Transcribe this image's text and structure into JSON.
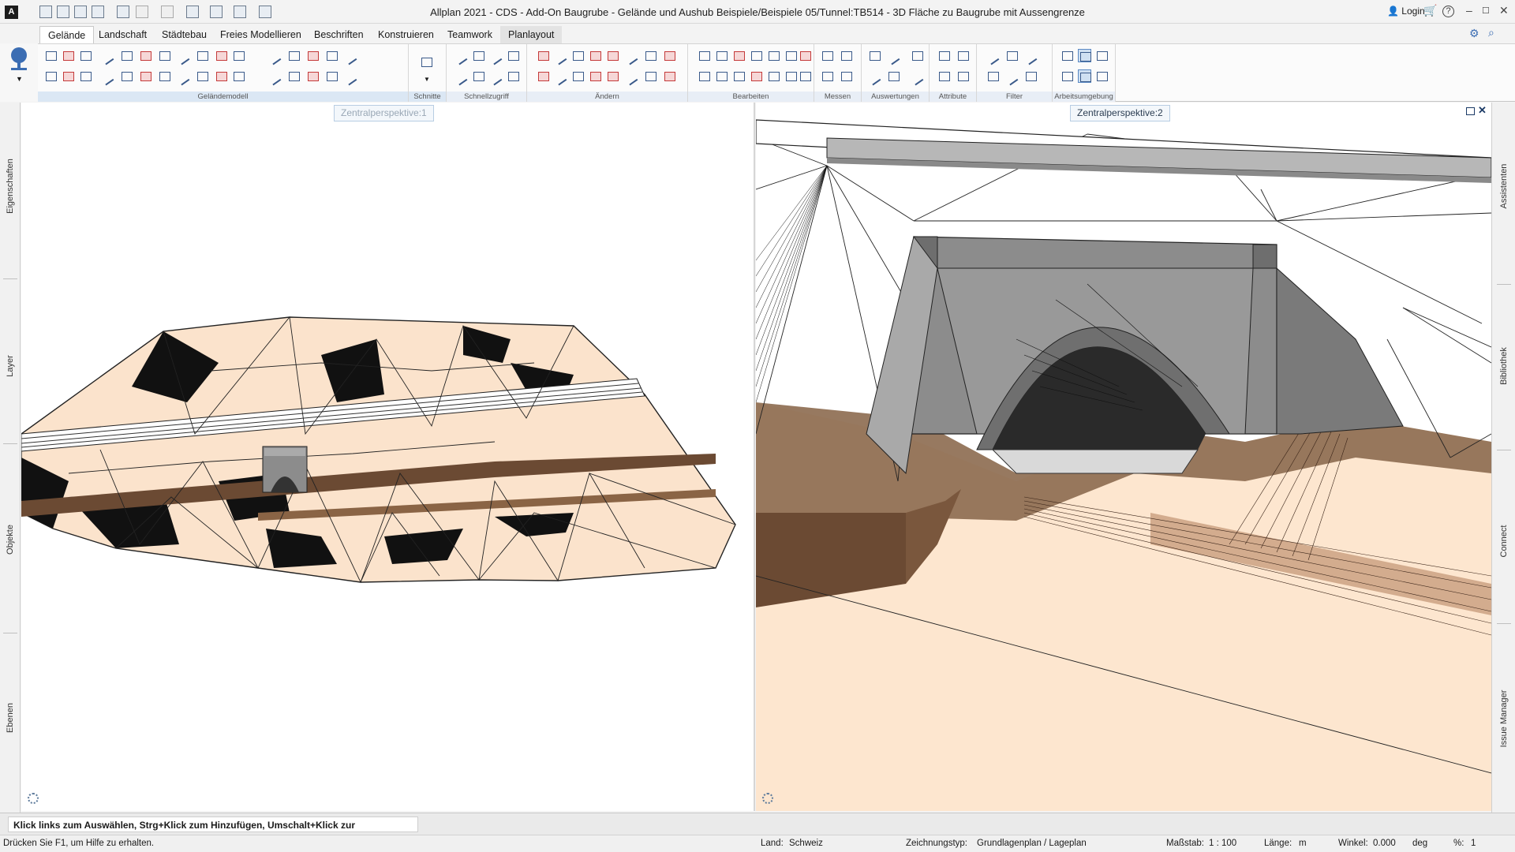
{
  "app": {
    "title": "Allplan 2021 - CDS - Add-On Baugrube - Gelände und Aushub Beispiele/Beispiele 05/Tunnel:TB514 - 3D Fläche zu Baugrube mit Aussengrenze",
    "logo_letter": "A",
    "login_label": "Login",
    "help_glyph": "?",
    "window_controls": [
      "–",
      "☐",
      "✕"
    ]
  },
  "tabs": [
    {
      "label": "Gelände",
      "active": true
    },
    {
      "label": "Landschaft"
    },
    {
      "label": "Städtebau"
    },
    {
      "label": "Freies Modellieren"
    },
    {
      "label": "Beschriften"
    },
    {
      "label": "Konstruieren"
    },
    {
      "label": "Teamwork"
    },
    {
      "label": "Planlayout"
    }
  ],
  "ribbon_groups": [
    {
      "label": "Geländemodell"
    },
    {
      "label": "Schnitte"
    },
    {
      "label": "Schnellzugriff"
    },
    {
      "label": "Ändern"
    },
    {
      "label": "Bearbeiten"
    },
    {
      "label": "Messen"
    },
    {
      "label": "Auswertungen"
    },
    {
      "label": "Attribute"
    },
    {
      "label": "Filter"
    },
    {
      "label": "Arbeitsumgebung"
    }
  ],
  "left_panel_tabs": [
    "Eigenschaften",
    "Layer",
    "Objekte",
    "Ebenen"
  ],
  "right_panel_tabs": [
    "Assistenten",
    "Bibliothek",
    "Connect",
    "Issue Manager"
  ],
  "viewports": [
    {
      "title": "Zentralperspektive:1",
      "active": false
    },
    {
      "title": "Zentralperspektive:2",
      "active": true
    }
  ],
  "colors": {
    "terrain": "#fbe3cc",
    "terrain_dark": "#6b4a33",
    "tunnel": "#8c8c8c",
    "accent": "#2a5ea8"
  },
  "command_prompt": "Klick links zum Auswählen, Strg+Klick zum Hinzufügen, Umschalt+Klick zur Segmentwahl",
  "status": {
    "help": "Drücken Sie F1, um Hilfe zu erhalten.",
    "land_label": "Land:",
    "land_value": "Schweiz",
    "drawing_type_label": "Zeichnungstyp:",
    "drawing_type_value": "Grundlagenplan / Lageplan",
    "scale_label": "Maßstab:",
    "scale_value": "1 : 100",
    "length_label": "Länge:",
    "length_value": "m",
    "angle_label": "Winkel:",
    "angle_value": "0.000",
    "angle_unit": "deg",
    "percent_label": "%:",
    "percent_value": "1"
  }
}
